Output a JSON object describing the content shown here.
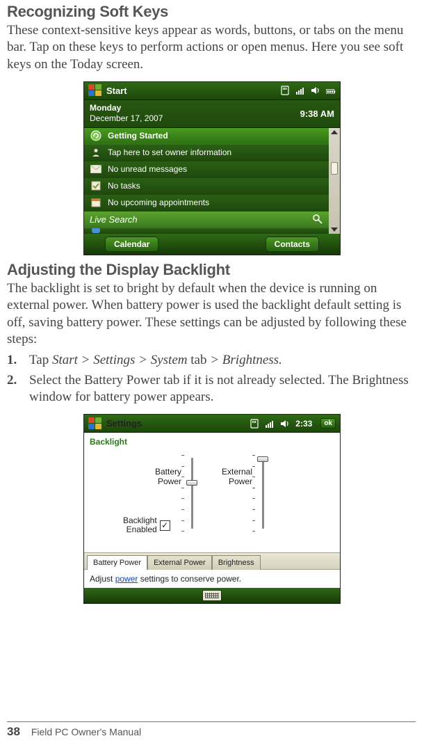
{
  "sections": {
    "softkeys": {
      "heading": "Recognizing Soft Keys",
      "paragraph": "These context-sensitive keys appear as words, buttons, or tabs on the menu bar. Tap on these keys to perform actions or open menus. Here you see soft keys on the Today screen."
    },
    "backlight": {
      "heading": "Adjusting the Display Backlight",
      "paragraph": "The backlight is set to bright by default when the device is running on external power. When battery power is used the backlight default setting is off, saving battery power. These settings can be adjusted by following these steps:",
      "steps": [
        {
          "num": "1.",
          "lead": "Tap ",
          "path": "Start > Settings > System",
          "mid": " tab ",
          "path2": "> Brightness.",
          "tail": ""
        },
        {
          "num": "2.",
          "text": "Select the Battery Power tab if it is not already selected. The Brightness window for battery power appears."
        }
      ]
    }
  },
  "today": {
    "titlebar": {
      "label": "Start",
      "time": "9:38 AM"
    },
    "date": {
      "dow": "Monday",
      "full": "December 17, 2007"
    },
    "rows": {
      "getting_started": "Getting Started",
      "owner": "Tap here to set owner information",
      "msgs": "No unread messages",
      "tasks": "No tasks",
      "appts": "No upcoming appointments"
    },
    "livesearch": "Live Search",
    "softkeys": {
      "left": "Calendar",
      "right": "Contacts"
    }
  },
  "settings": {
    "titlebar": {
      "label": "Settings",
      "time": "2:33",
      "ok": "ok"
    },
    "pane_title": "Backlight",
    "sliders": {
      "battery_label": "Battery\nPower",
      "external_label": "External\nPower",
      "backlight_enabled_label": "Backlight\nEnabled",
      "backlight_enabled_checked": true
    },
    "tabs": [
      "Battery Power",
      "External Power",
      "Brightness"
    ],
    "active_tab": 0,
    "hint_before": "Adjust ",
    "hint_link": "power",
    "hint_after": " settings to conserve power."
  },
  "footer": {
    "page": "38",
    "title": "Field PC Owner's Manual"
  }
}
